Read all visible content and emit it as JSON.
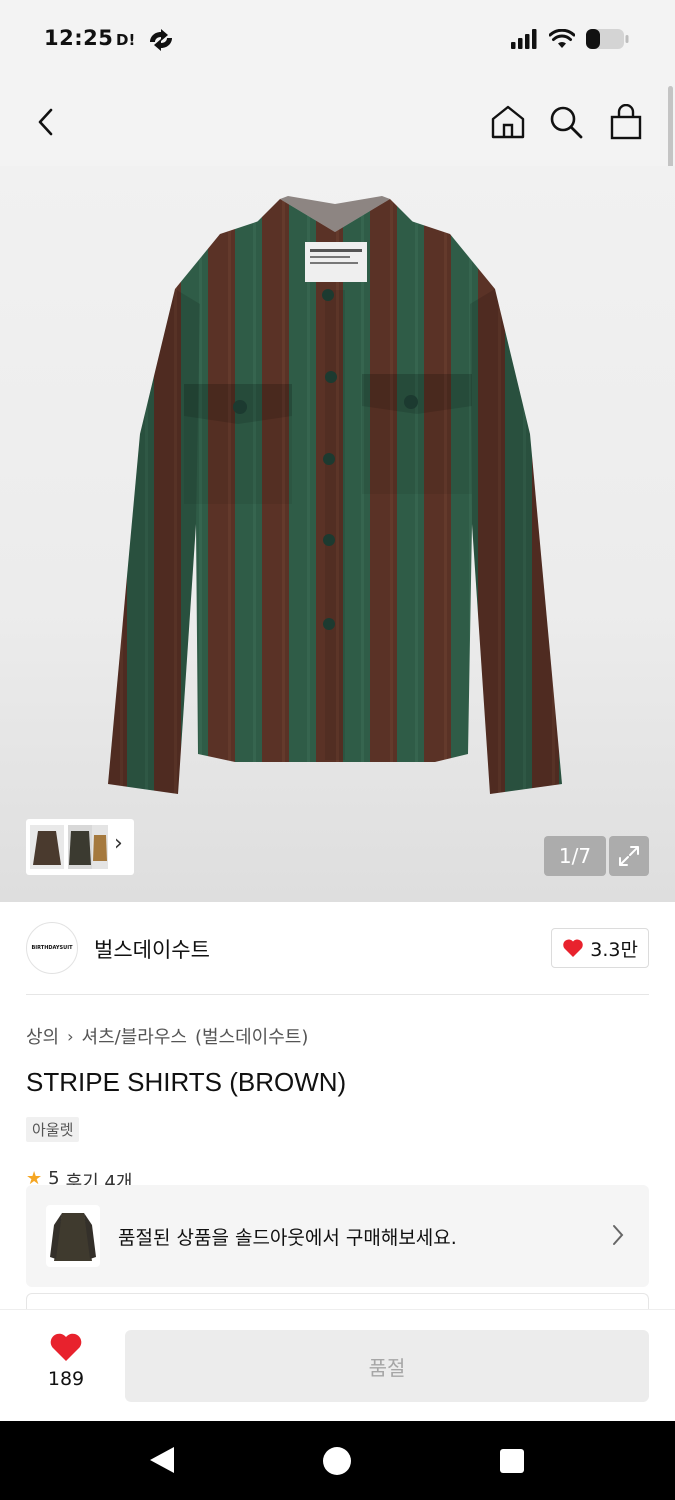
{
  "status_bar": {
    "time": "12:25",
    "app_label": "D!",
    "battery_level": 0.3
  },
  "top_nav": {
    "back_icon": "chevron-left-icon",
    "home_icon": "home-icon",
    "search_icon": "search-icon",
    "bag_icon": "shopping-bag-icon"
  },
  "gallery": {
    "page_counter": "1/7",
    "expand_icon": "expand-icon",
    "shirt_colors": [
      "#5a3226",
      "#2f5c47"
    ]
  },
  "brand": {
    "logo_text": "BIRTHDAYSUIT",
    "name": "벌스데이수트",
    "likes": "3.3만"
  },
  "product": {
    "breadcrumb": [
      "상의",
      "셔츠/블라우스",
      "(벌스데이수트)"
    ],
    "title": "STRIPE SHIRTS (BROWN)",
    "badge": "아울렛",
    "rating": "5",
    "reviews": "후기 4개"
  },
  "soldout_banner": {
    "text": "품절된 상품을 솔드아웃에서 구매해보세요."
  },
  "bottom_bar": {
    "wish_count": "189",
    "buy_label": "품절",
    "accent": "#e8222d"
  }
}
